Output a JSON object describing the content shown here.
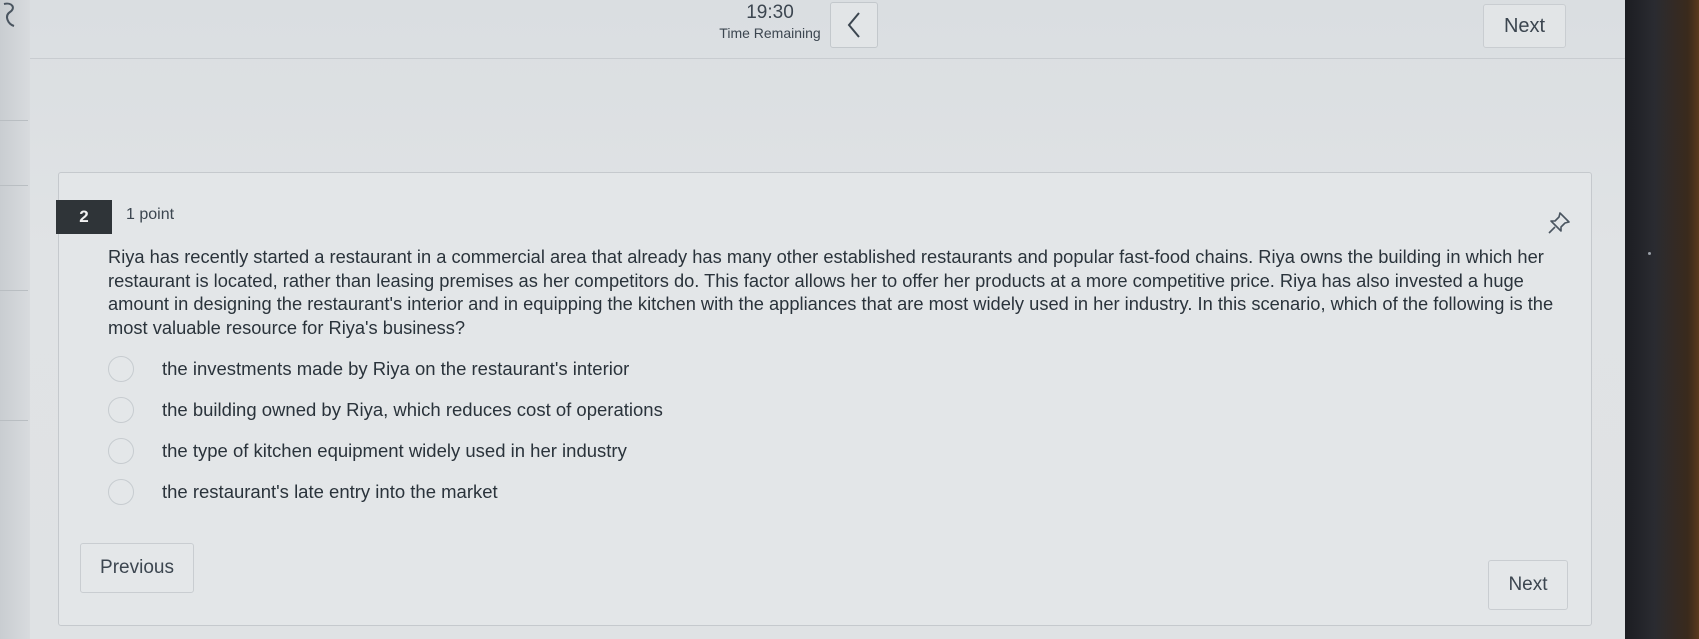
{
  "timer": {
    "value": "19:30",
    "label": "Time Remaining"
  },
  "nav": {
    "top_next_label": "Next",
    "previous_label": "Previous",
    "bottom_next_label": "Next"
  },
  "question": {
    "number": "2",
    "points": "1 point",
    "text": "Riya has recently started a restaurant in a commercial area that already has many other established restaurants and popular fast-food chains. Riya owns the building in which her restaurant is located, rather than leasing premises as her competitors do. This factor allows her to offer her products at a more competitive price. Riya has also invested a huge amount in designing the restaurant's interior and in equipping the kitchen with the appliances that are most widely used in her industry. In this scenario, which of the following is the most valuable resource for Riya's business?",
    "options": [
      {
        "label": "the investments made by Riya on the restaurant's interior"
      },
      {
        "label": "the building owned by Riya, which reduces cost of operations"
      },
      {
        "label": "the type of kitchen equipment widely used in her industry"
      },
      {
        "label": "the restaurant's late entry into the market"
      }
    ]
  },
  "icons": {
    "corner": "bookmark-flag-icon",
    "back": "chevron-left-icon",
    "pin": "pin-icon"
  }
}
